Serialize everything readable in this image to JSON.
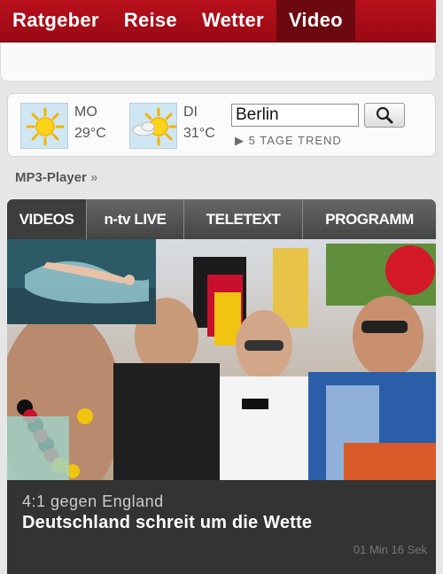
{
  "topnav": {
    "items": [
      {
        "label": "Ratgeber",
        "active": false
      },
      {
        "label": "Reise",
        "active": false
      },
      {
        "label": "Wetter",
        "active": false
      },
      {
        "label": "Video",
        "active": true
      }
    ]
  },
  "weather": {
    "days": [
      {
        "day": "MO",
        "temp": "29°C",
        "icon": "sun-icon"
      },
      {
        "day": "DI",
        "temp": "31°C",
        "icon": "sun-cloud-icon"
      }
    ],
    "city_value": "Berlin",
    "trend_label": "5 TAGE TREND"
  },
  "breadcrumb": {
    "label": "MP3-Player",
    "separator": "»"
  },
  "tabs": [
    {
      "label": "VIDEOS",
      "active": true
    },
    {
      "label": "n-tv LIVE",
      "active": false
    },
    {
      "label": "TELETEXT",
      "active": false
    },
    {
      "label": "PROGRAMM",
      "active": false
    }
  ],
  "video": {
    "kicker": "4:1 gegen England",
    "headline": "Deutschland schreit um die Wette",
    "duration": "01 Min 16 Sek"
  },
  "colors": {
    "brand_red": "#b8101c",
    "active_dark_red": "#6c0810",
    "panel_dark": "#333333"
  }
}
